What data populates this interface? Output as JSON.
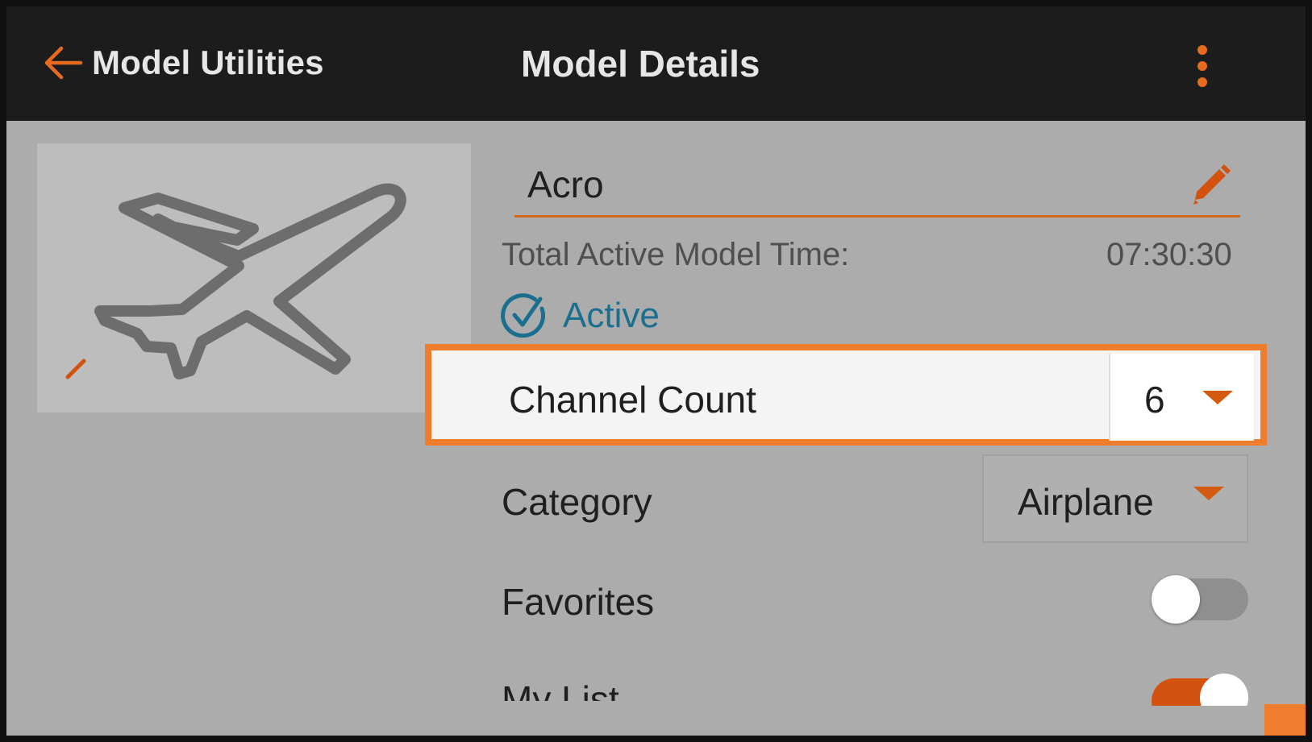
{
  "colors": {
    "accent": "#e66b1e",
    "highlight_border": "#ef7d2d",
    "header_bg": "#1c1c1c",
    "content_bg": "#acacac",
    "active_blue": "#1b6f8e"
  },
  "header": {
    "back_label": "Model Utilities",
    "back_icon": "arrow-left-icon",
    "title": "Model Details",
    "menu_icon": "more-vertical-icon"
  },
  "thumbnail": {
    "icon": "airplane-icon",
    "edit_icon": "pencil-icon"
  },
  "model": {
    "name": "Acro",
    "edit_icon": "pencil-icon",
    "time_label": "Total Active Model Time:",
    "time_value": "07:30:30",
    "status_label": "Active",
    "status_icon": "check-circle-icon"
  },
  "settings": {
    "channel_count_label": "Channel Count",
    "channel_count_value": "6",
    "category_label": "Category",
    "category_value": "Airplane",
    "favorites_label": "Favorites",
    "favorites_on": false,
    "mylist_label": "My List",
    "mylist_on": true
  }
}
